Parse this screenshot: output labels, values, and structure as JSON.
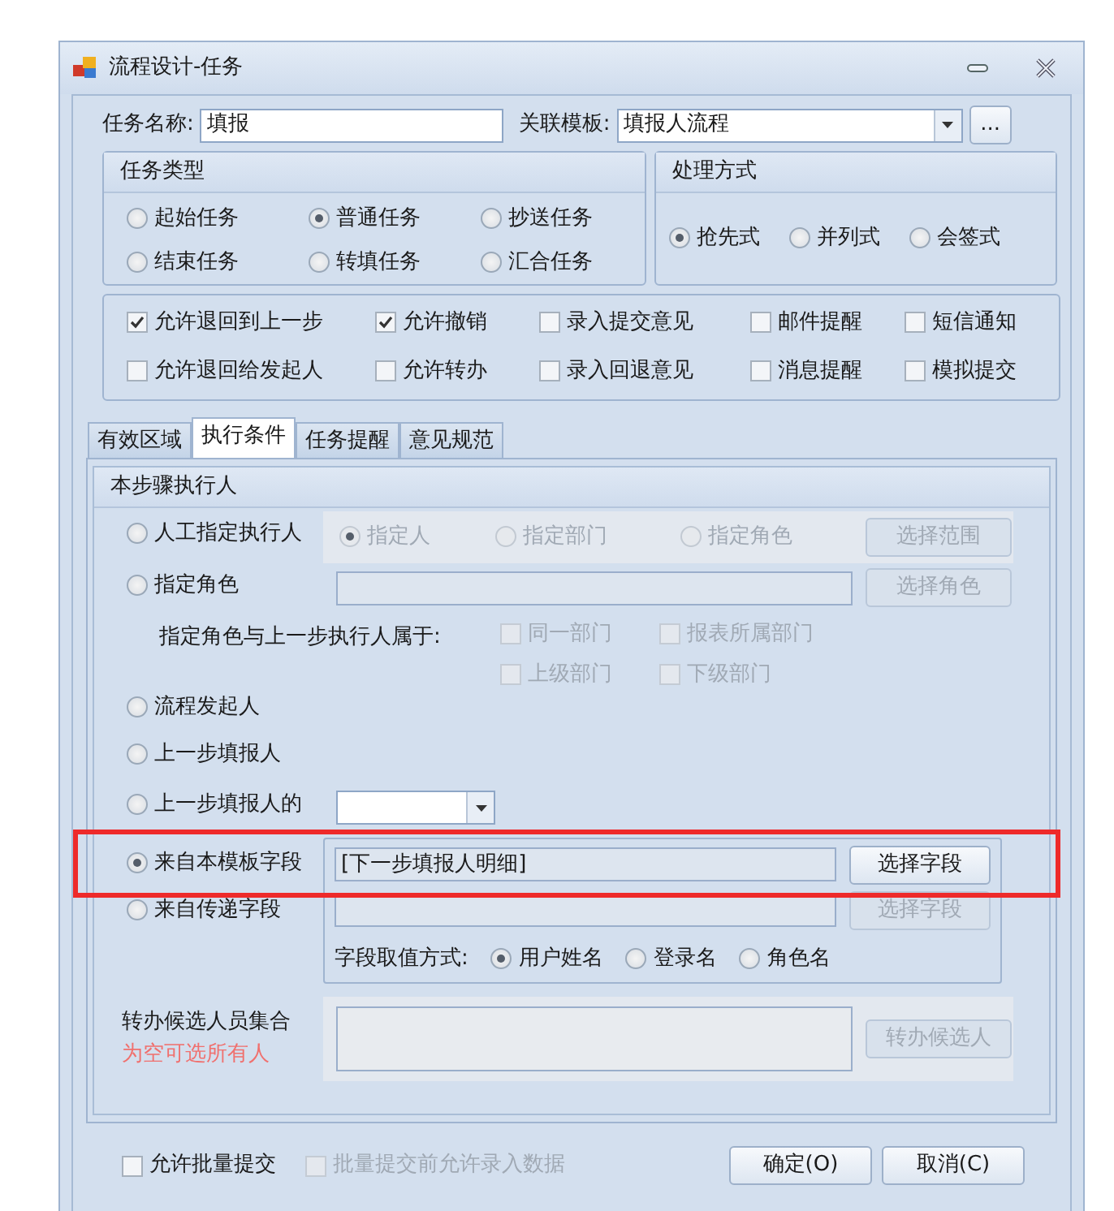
{
  "window": {
    "title": "流程设计-任务"
  },
  "task_name": {
    "label": "任务名称:",
    "value": "填报"
  },
  "template": {
    "label": "关联模板:",
    "value": "填报人流程",
    "more_button": "..."
  },
  "task_type": {
    "title": "任务类型",
    "options": [
      {
        "label": "起始任务",
        "selected": false
      },
      {
        "label": "普通任务",
        "selected": true
      },
      {
        "label": "抄送任务",
        "selected": false
      },
      {
        "label": "结束任务",
        "selected": false
      },
      {
        "label": "转填任务",
        "selected": false
      },
      {
        "label": "汇合任务",
        "selected": false
      }
    ]
  },
  "handling": {
    "title": "处理方式",
    "options": [
      {
        "label": "抢先式",
        "selected": true
      },
      {
        "label": "并列式",
        "selected": false
      },
      {
        "label": "会签式",
        "selected": false
      }
    ]
  },
  "permissions": [
    {
      "label": "允许退回到上一步",
      "checked": true
    },
    {
      "label": "允许撤销",
      "checked": true
    },
    {
      "label": "录入提交意见",
      "checked": false
    },
    {
      "label": "邮件提醒",
      "checked": false
    },
    {
      "label": "短信通知",
      "checked": false
    },
    {
      "label": "允许退回给发起人",
      "checked": false
    },
    {
      "label": "允许转办",
      "checked": false
    },
    {
      "label": "录入回退意见",
      "checked": false
    },
    {
      "label": "消息提醒",
      "checked": false
    },
    {
      "label": "模拟提交",
      "checked": false
    }
  ],
  "tabs": [
    {
      "label": "有效区域",
      "selected": false
    },
    {
      "label": "执行条件",
      "selected": true
    },
    {
      "label": "任务提醒",
      "selected": false
    },
    {
      "label": "意见规范",
      "selected": false
    }
  ],
  "executor": {
    "title": "本步骤执行人",
    "manual": {
      "label": "人工指定执行人",
      "selected": false,
      "choices": [
        {
          "label": "指定人",
          "selected": true,
          "disabled": true
        },
        {
          "label": "指定部门",
          "selected": false,
          "disabled": true
        },
        {
          "label": "指定角色",
          "selected": false,
          "disabled": true
        }
      ],
      "button": {
        "label": "选择范围",
        "disabled": true
      }
    },
    "role": {
      "label": "指定角色",
      "selected": false,
      "button": {
        "label": "选择角色",
        "disabled": true
      }
    },
    "relation": {
      "label": "指定角色与上一步执行人属于:",
      "checks": [
        {
          "label": "同一部门",
          "checked": false,
          "disabled": true
        },
        {
          "label": "报表所属部门",
          "checked": false,
          "disabled": true
        },
        {
          "label": "上级部门",
          "checked": false,
          "disabled": true
        },
        {
          "label": "下级部门",
          "checked": false,
          "disabled": true
        }
      ]
    },
    "initiator": {
      "label": "流程发起人",
      "selected": false
    },
    "previous": {
      "label": "上一步填报人",
      "selected": false
    },
    "previous_of": {
      "label": "上一步填报人的",
      "selected": false
    },
    "template_field": {
      "label": "来自本模板字段",
      "selected": true,
      "highlighted": true,
      "value": "[下一步填报人明细]",
      "button": {
        "label": "选择字段",
        "disabled": false
      }
    },
    "passed_field": {
      "label": "来自传递字段",
      "selected": false,
      "button": {
        "label": "选择字段",
        "disabled": true
      }
    },
    "value_mode": {
      "label": "字段取值方式:",
      "options": [
        {
          "label": "用户姓名",
          "selected": true
        },
        {
          "label": "登录名",
          "selected": false
        },
        {
          "label": "角色名",
          "selected": false
        }
      ]
    },
    "transfer": {
      "label": "转办候选人员集合",
      "hint": "为空可选所有人",
      "button": {
        "label": "转办候选人",
        "disabled": true
      }
    }
  },
  "footer": {
    "checks": [
      {
        "label": "允许批量提交",
        "checked": false,
        "disabled": false
      },
      {
        "label": "批量提交前允许录入数据",
        "checked": false,
        "disabled": true
      }
    ],
    "buttons": [
      {
        "label": "确定(O)"
      },
      {
        "label": "取消(C)"
      }
    ]
  }
}
